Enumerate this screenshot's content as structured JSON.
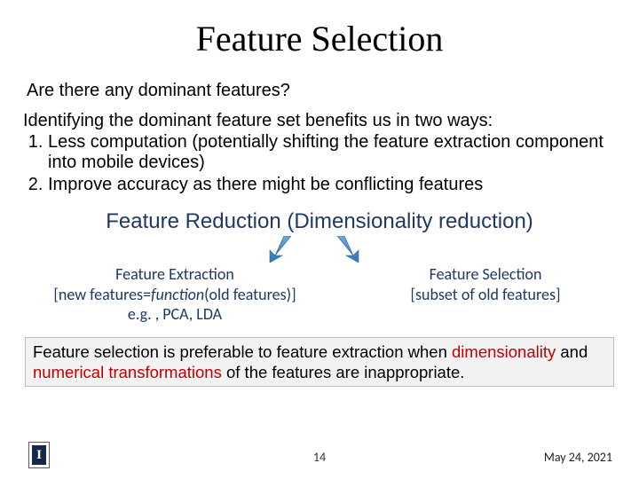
{
  "title": "Feature Selection",
  "question": "Are there any dominant features?",
  "intro": "Identifying the dominant feature set benefits us in two ways:",
  "points": [
    "Less computation (potentially shifting the feature extraction component into mobile devices)",
    "Improve accuracy as there might be conflicting features"
  ],
  "reduction_title": "Feature Reduction (Dimensionality reduction)",
  "left": {
    "h": "Feature Extraction",
    "l1a": "[new features=",
    "l1b": "function",
    "l1c": "(old features)]",
    "l2": "e.g. , PCA, LDA"
  },
  "right": {
    "h": "Feature Selection",
    "l1": "[subset of old  features]"
  },
  "callout": {
    "t1": "Feature selection is preferable to feature extraction when ",
    "r1": "dimensionality",
    "t2": " and ",
    "r2": "numerical transformations",
    "t3": " of the features are inappropriate."
  },
  "footer": {
    "logo_letter": "I",
    "page": "14",
    "date": "May 24, 2021"
  }
}
